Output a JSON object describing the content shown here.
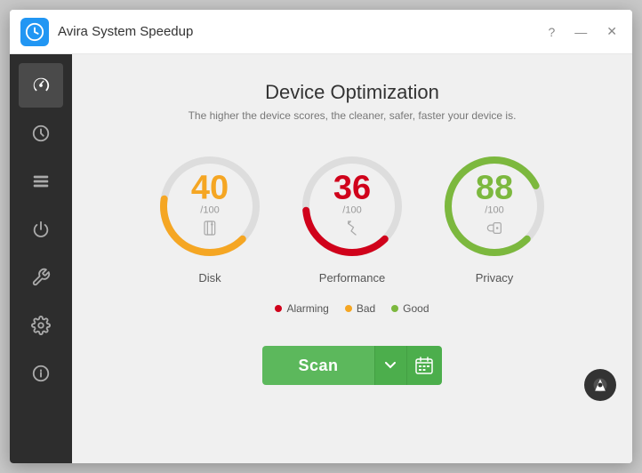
{
  "window": {
    "title": "Avira System Speedup",
    "help_label": "?",
    "minimize_label": "—",
    "close_label": "✕"
  },
  "sidebar": {
    "items": [
      {
        "id": "speedup",
        "icon": "speedometer-icon",
        "active": true
      },
      {
        "id": "clock",
        "icon": "clock-icon",
        "active": false
      },
      {
        "id": "modules",
        "icon": "modules-icon",
        "active": false
      },
      {
        "id": "startup",
        "icon": "startup-icon",
        "active": false
      },
      {
        "id": "tools",
        "icon": "tools-icon",
        "active": false
      },
      {
        "id": "settings",
        "icon": "settings-icon",
        "active": false
      },
      {
        "id": "info",
        "icon": "info-icon",
        "active": false
      }
    ]
  },
  "content": {
    "title": "Device Optimization",
    "subtitle": "The higher the device scores, the cleaner, safer, faster your device is.",
    "gauges": [
      {
        "id": "disk",
        "score": "40",
        "max": "/100",
        "color_class": "orange",
        "label": "Disk",
        "percent": 40,
        "icon": "disk-icon"
      },
      {
        "id": "performance",
        "score": "36",
        "max": "/100",
        "color_class": "red",
        "label": "Performance",
        "percent": 36,
        "icon": "performance-icon"
      },
      {
        "id": "privacy",
        "score": "88",
        "max": "/100",
        "color_class": "green",
        "label": "Privacy",
        "percent": 88,
        "icon": "privacy-icon"
      }
    ],
    "legend": [
      {
        "label": "Alarming",
        "color": "#d0021b"
      },
      {
        "label": "Bad",
        "color": "#f5a623"
      },
      {
        "label": "Good",
        "color": "#7cb83e"
      }
    ]
  },
  "scan_button": {
    "label": "Scan",
    "dropdown_label": "▾",
    "calendar_label": "📅"
  }
}
